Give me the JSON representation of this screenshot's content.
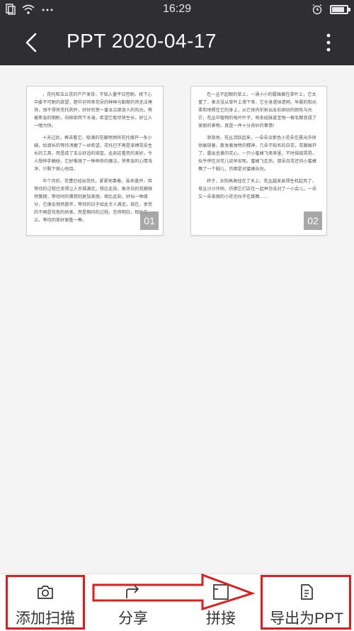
{
  "status_bar": {
    "time": "16:29",
    "left_icons": [
      "sim-icon",
      "wifi-icon",
      "more-dots-icon"
    ],
    "right_icons": [
      "alarm-icon",
      "battery-icon"
    ],
    "battery_level": 0.85
  },
  "header": {
    "title": "PPT 2020-04-17",
    "back_icon": "chevron-left-icon",
    "menu_icon": "more-vertical-icon"
  },
  "pages": [
    {
      "number": "01",
      "paragraphs": [
        "，花托和玉兰花的产产发芽，不知入量平日宫耐。按下心中委不可耐的欲望，题中对将来花朵的种种与勤期仍然无法掩饰，恨不得将花托剥开，好好欣赏一番玉兰那迷人的风光，等着焦急的期盼，向柳部西下水淹，希望它能尽快生长，好让人一睹为快。",
        "十天过后，再去看它，吸满的花瓣悄悄将花托撑开一条小缝，给渡长的等待消磨了一丝希望。花托已不再是束缚花朵生长的工具，而是成了玉兰舒适的摇篮。此刻这看势的美好，令人想伸手触碰，它好像施了一种神奇的魔法，将焦急的心情洗净，只剩下爽心悦目。",
        "半个月后，花蕾已经出花托，紧紧地靠着，虽未盛开，但等待的过程已变得让人幸福满足。想比此前，象牙白的花瓣微然簇拥，等待时的猜想则更加美丽，相比此刻，好似一种缘分，它便会悄然盛开，等待的日子如此令人满足。现在，享受的不再是花苞的娇美，而是期待的过程。忽然明白，相比玉兰，等待的美好更胜一筹。"
      ]
    },
    {
      "number": "02",
      "paragraphs": [
        "在一丛不起眼的草上，一涌小小的露珠躺在草叶上，它太重了，差点没从草叶上滑下来，它全身透体透明，早晨的阳光柔和地照在它的身上，从它体内折射出五彩缤纷的颜色与光芒，花丛中植物的每片叶子，每条经脉甚至每一根毛都变成了美丽的景物，真是一件十分奇妙的事情！",
        "渐渐地，花丛活跃起来，一朵朵淡紫色小花朵在晨光中徐徐展现着，散发着独特的精神，几朵不知名的白花，花瓣展开了，露出金黄的花心，一只小蜜蜂飞来来里，不时摇摇晃晃，似乎停在对花儿说早安呢。蜜蜂飞走后，那朵白花还向小蜜蜂舞了一个脚儿，仿佛是对蜜蜂告别。",
        "终于，太阳高高挂在了天上，花丛越发显得生机起风了，草丛沙沙作响，仿佛它们正在一起举办派对了一小会儿，一朵又一朵美丽的小花也似乎在跳舞……"
      ]
    }
  ],
  "toolbar": {
    "items": [
      {
        "label": "添加扫描",
        "icon": "camera-icon"
      },
      {
        "label": "分享",
        "icon": "share-icon"
      },
      {
        "label": "拼接",
        "icon": "image-frame-icon"
      },
      {
        "label": "导出为PPT",
        "icon": "document-export-icon"
      }
    ]
  },
  "annotation": {
    "color": "#e21c1c"
  },
  "colors": {
    "header_bg": "#2f2f31",
    "content_bg": "#f4f4f4",
    "page_num_bg": "#9e9e9e"
  }
}
